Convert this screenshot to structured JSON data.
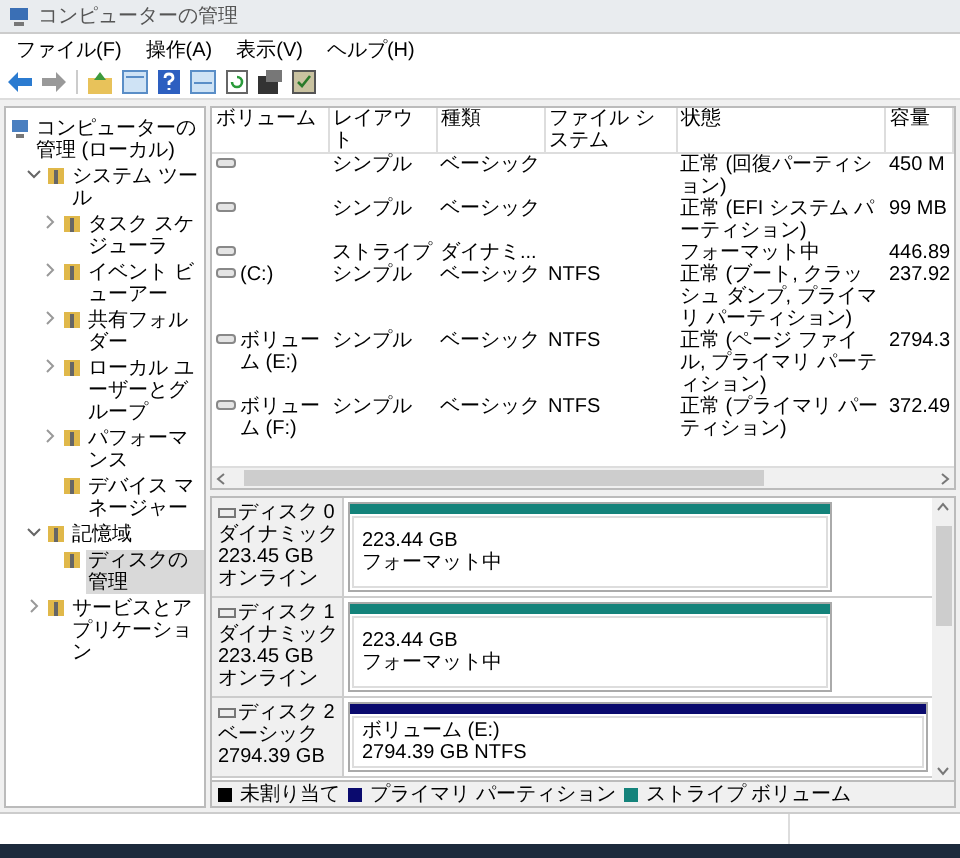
{
  "window": {
    "title": "コンピューターの管理"
  },
  "menu": [
    "ファイル(F)",
    "操作(A)",
    "表示(V)",
    "ヘルプ(H)"
  ],
  "tree": [
    {
      "label": "コンピューターの管理 (ローカル)",
      "selected": false,
      "children": [
        {
          "label": "システム ツール",
          "expanded": true,
          "selected": false,
          "children": [
            {
              "label": "タスク スケジューラ",
              "expanded": false,
              "selected": false
            },
            {
              "label": "イベント ビューアー",
              "expanded": false,
              "selected": false
            },
            {
              "label": "共有フォルダー",
              "expanded": false,
              "selected": false
            },
            {
              "label": "ローカル ユーザーとグループ",
              "expanded": false,
              "selected": false
            },
            {
              "label": "パフォーマンス",
              "expanded": false,
              "selected": false
            },
            {
              "label": "デバイス マネージャー",
              "selected": false
            }
          ]
        },
        {
          "label": "記憶域",
          "expanded": true,
          "selected": false,
          "children": [
            {
              "label": "ディスクの管理",
              "selected": true
            }
          ]
        },
        {
          "label": "サービスとアプリケーション",
          "expanded": false,
          "selected": false
        }
      ]
    }
  ],
  "volume_table": {
    "columns": [
      "ボリューム",
      "レイアウト",
      "種類",
      "ファイル システム",
      "状態",
      "容量"
    ],
    "rows": [
      [
        "",
        "シンプル",
        "ベーシック",
        "",
        "正常 (回復パーティション)",
        "450 M"
      ],
      [
        "",
        "シンプル",
        "ベーシック",
        "",
        "正常 (EFI システム パーティション)",
        "99 MB"
      ],
      [
        "",
        "ストライプ",
        "ダイナミ...",
        "",
        "フォーマット中",
        "446.89"
      ],
      [
        "(C:)",
        "シンプル",
        "ベーシック",
        "NTFS",
        "正常 (ブート, クラッシュ ダンプ, プライマリ パーティション)",
        "237.92"
      ],
      [
        "ボリューム (E:)",
        "シンプル",
        "ベーシック",
        "NTFS",
        "正常 (ページ ファイル, プライマリ パーティション)",
        "2794.3"
      ],
      [
        "ボリューム (F:)",
        "シンプル",
        "ベーシック",
        "NTFS",
        "正常 (プライマリ パーティション)",
        "372.49"
      ]
    ]
  },
  "disks": [
    {
      "name": "ディスク 0",
      "type": "ダイナミック",
      "size": "223.45 GB",
      "status": "オンライン",
      "partitions": [
        {
          "color": "#14837b",
          "lines": [
            "223.44 GB",
            "フォーマット中"
          ]
        }
      ]
    },
    {
      "name": "ディスク 1",
      "type": "ダイナミック",
      "size": "223.45 GB",
      "status": "オンライン",
      "partitions": [
        {
          "color": "#14837b",
          "lines": [
            "223.44 GB",
            "フォーマット中"
          ]
        }
      ]
    },
    {
      "name": "ディスク 2",
      "type": "ベーシック",
      "size": "2794.39 GB",
      "partitions": [
        {
          "color": "#0a0a6e",
          "lines": [
            "ボリューム (E:)",
            "2794.39 GB NTFS"
          ]
        }
      ]
    }
  ],
  "legend": [
    {
      "label": "未割り当て",
      "color": "#000000"
    },
    {
      "label": "プライマリ パーティション",
      "color": "#0a0a6e"
    },
    {
      "label": "ストライプ ボリューム",
      "color": "#14837b"
    }
  ]
}
